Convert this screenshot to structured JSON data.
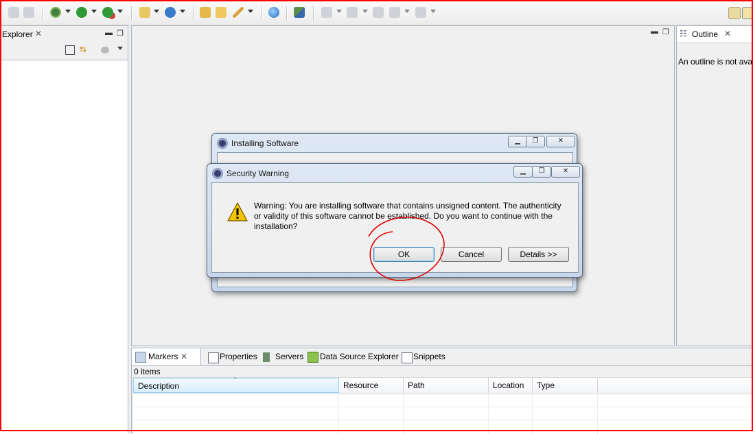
{
  "explorer": {
    "title": "Explorer"
  },
  "outline": {
    "title": "Outline",
    "message": "An outline is not available."
  },
  "bottom_tabs": [
    {
      "label": "Markers"
    },
    {
      "label": "Properties"
    },
    {
      "label": "Servers"
    },
    {
      "label": "Data Source Explorer"
    },
    {
      "label": "Snippets"
    }
  ],
  "markers": {
    "count": "0 items",
    "columns": [
      "Description",
      "Resource",
      "Path",
      "Location",
      "Type"
    ]
  },
  "installing_dialog": {
    "title": "Installing Software"
  },
  "security_dialog": {
    "title": "Security Warning",
    "message": "Warning: You are installing software that contains unsigned content. The authenticity or validity of this software cannot be established. Do you want to continue with the installation?",
    "ok": "OK",
    "cancel": "Cancel",
    "details": "Details >>"
  },
  "icons": [
    "bug-icon",
    "run-icon",
    "external-tools-icon",
    "new-server-icon",
    "new-file-icon",
    "open-folder-icon",
    "pen-icon",
    "globe-icon",
    "search-icon",
    "back-icon",
    "forward-icon",
    "warning-icon",
    "outline-icon",
    "markers-icon",
    "properties-icon",
    "servers-icon",
    "data-source-icon",
    "snippets-icon"
  ],
  "colors": {
    "annotation": "#e00000",
    "frame": "#ff0000",
    "dialog_title_bar": "#c7d7ea"
  }
}
